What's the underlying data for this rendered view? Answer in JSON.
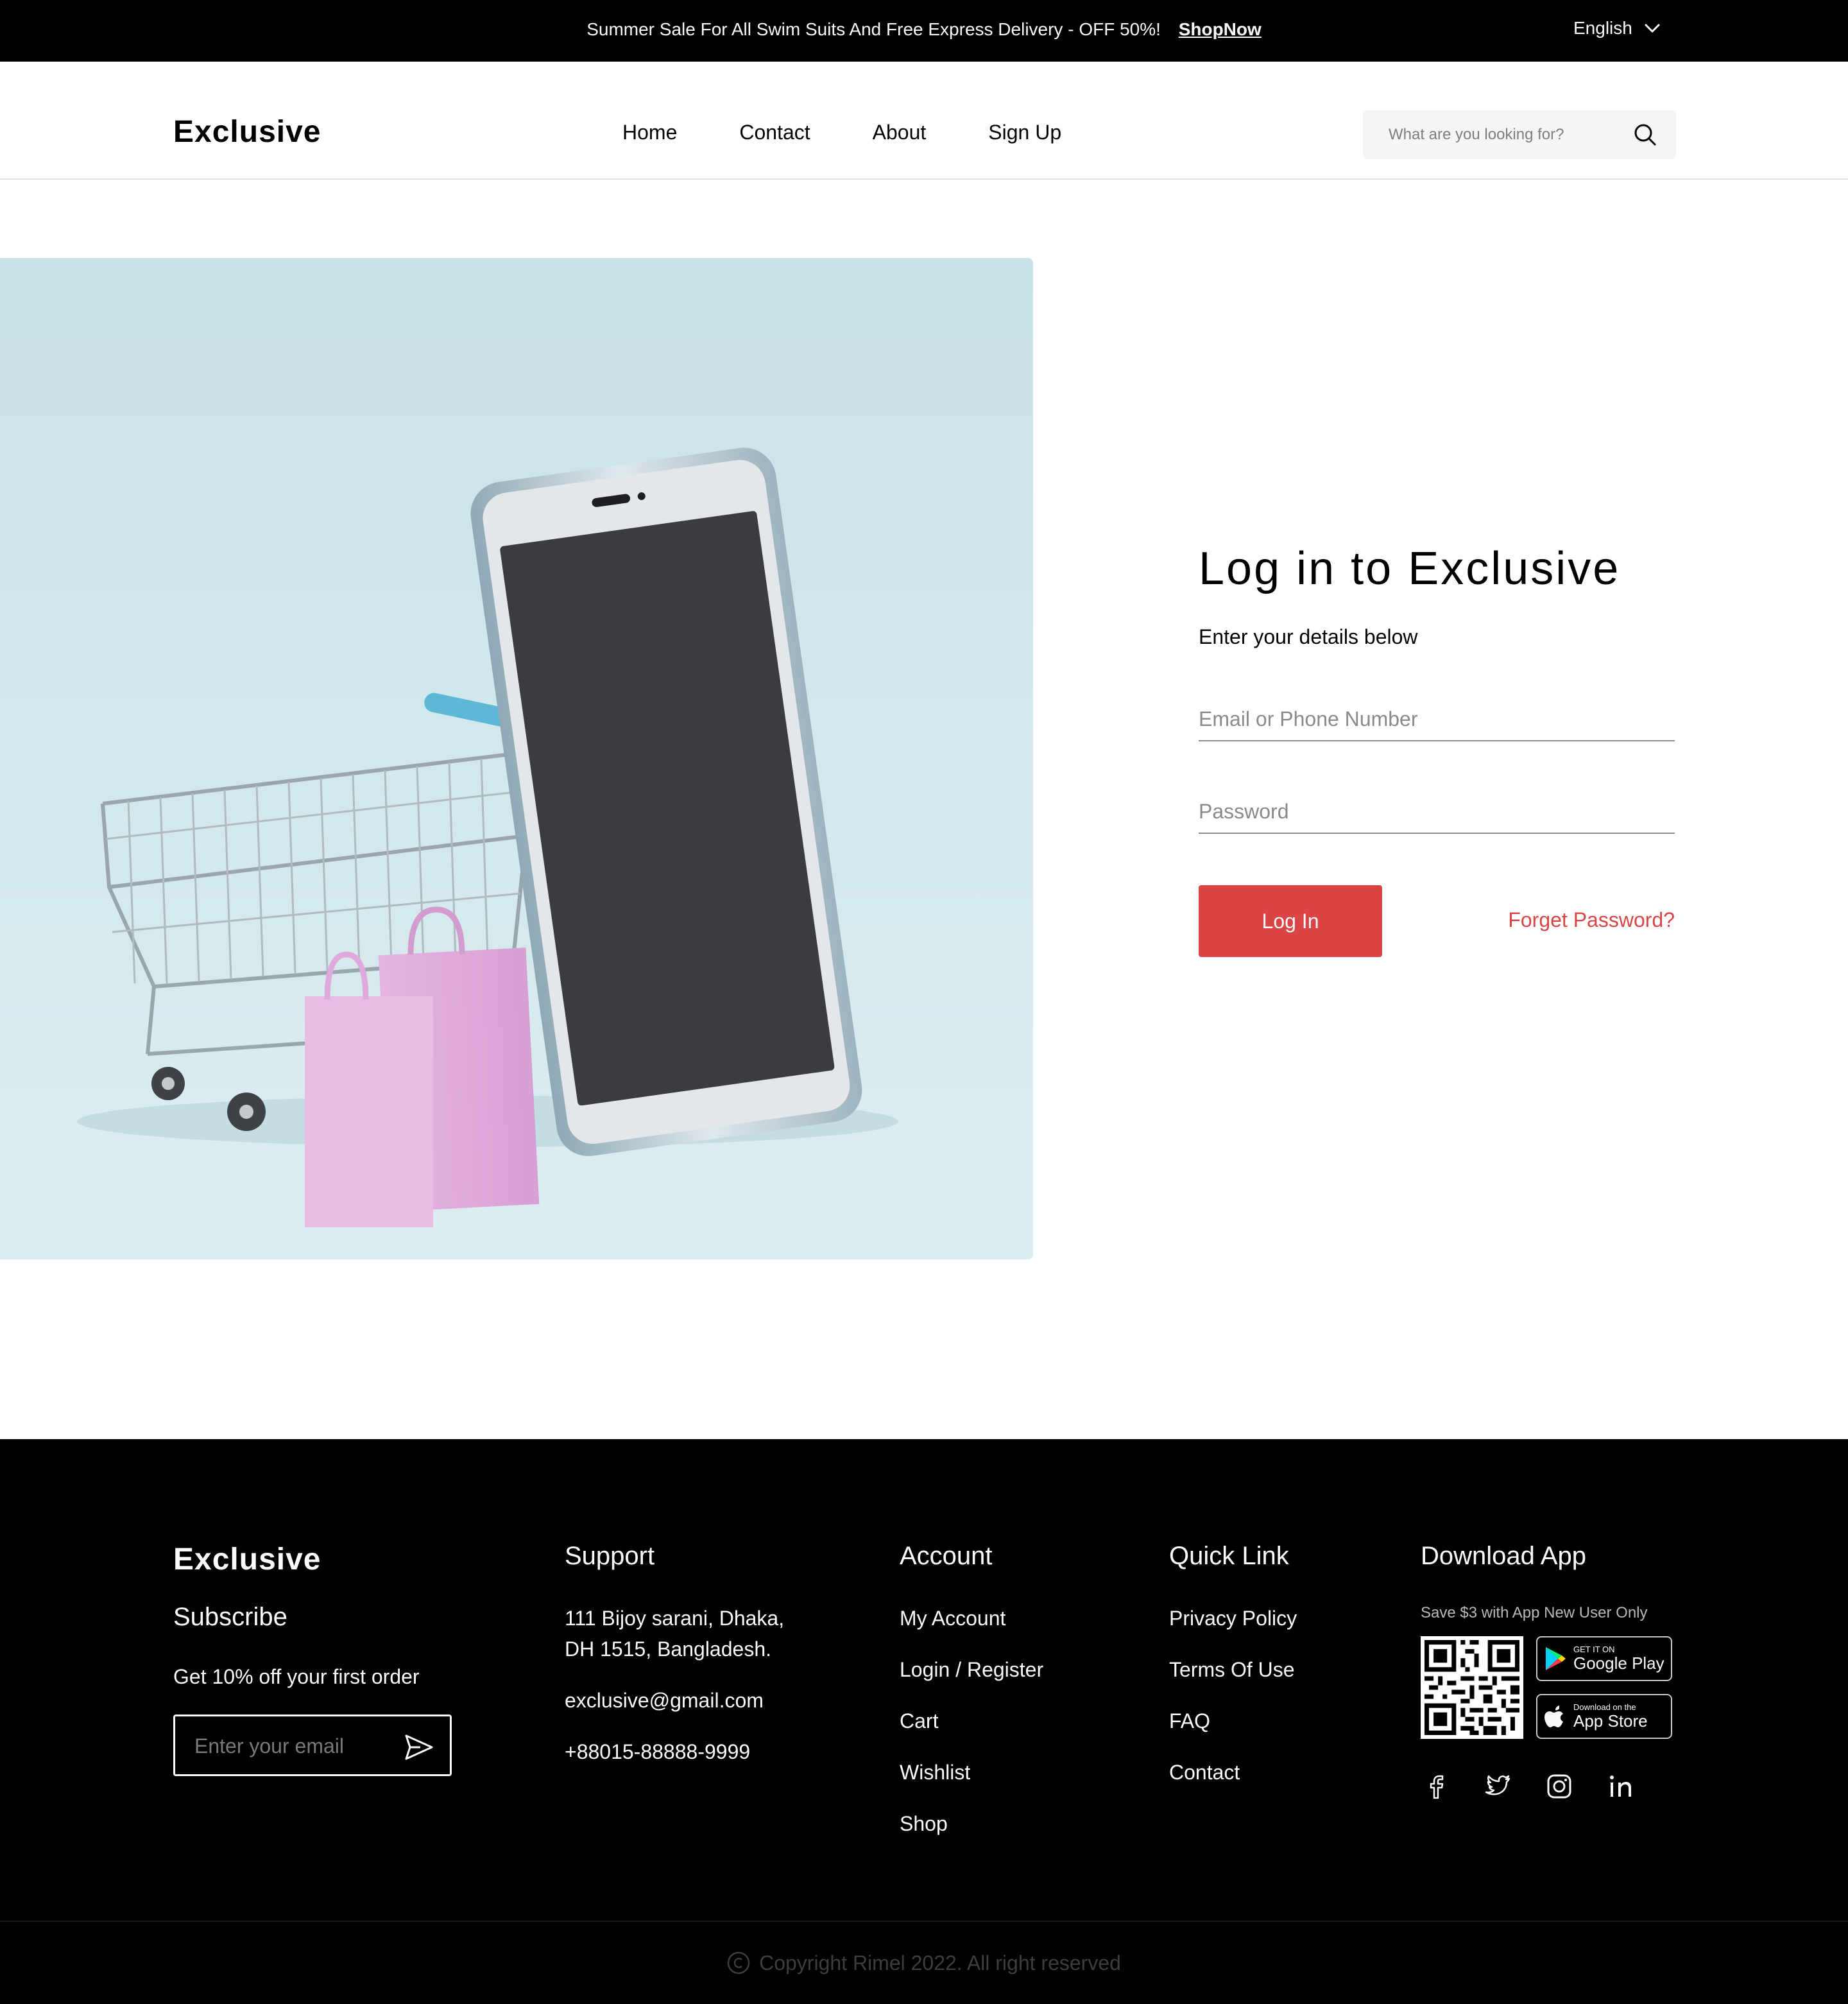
{
  "topbar": {
    "promo_text": "Summer Sale For All Swim Suits And Free Express Delivery - OFF 50%!",
    "promo_link": "ShopNow",
    "language": "English"
  },
  "header": {
    "logo": "Exclusive",
    "nav": [
      "Home",
      "Contact",
      "About",
      "Sign Up"
    ],
    "search_placeholder": "What are you looking for?"
  },
  "login": {
    "title": "Log in to Exclusive",
    "subtitle": "Enter your details below",
    "email_placeholder": "Email or Phone Number",
    "password_placeholder": "Password",
    "login_button": "Log In",
    "forgot_link": "Forget Password?",
    "accent_color": "#DB4444"
  },
  "footer": {
    "brand": "Exclusive",
    "subscribe_heading": "Subscribe",
    "subscribe_text": "Get 10% off your first order",
    "email_placeholder": "Enter your email",
    "support": {
      "heading": "Support",
      "address_line1": "111 Bijoy sarani, Dhaka,",
      "address_line2": "DH 1515, Bangladesh.",
      "email": "exclusive@gmail.com",
      "phone": "+88015-88888-9999"
    },
    "account": {
      "heading": "Account",
      "links": [
        "My Account",
        "Login / Register",
        "Cart",
        "Wishlist",
        "Shop"
      ]
    },
    "quick_link": {
      "heading": "Quick Link",
      "links": [
        "Privacy Policy",
        "Terms Of Use",
        "FAQ",
        "Contact"
      ]
    },
    "download": {
      "heading": "Download App",
      "note": "Save $3 with App New User Only",
      "google_small": "GET IT ON",
      "google_big": "Google Play",
      "apple_small": "Download on the",
      "apple_big": "App Store"
    },
    "copyright": "Copyright Rimel 2022. All right reserved"
  }
}
